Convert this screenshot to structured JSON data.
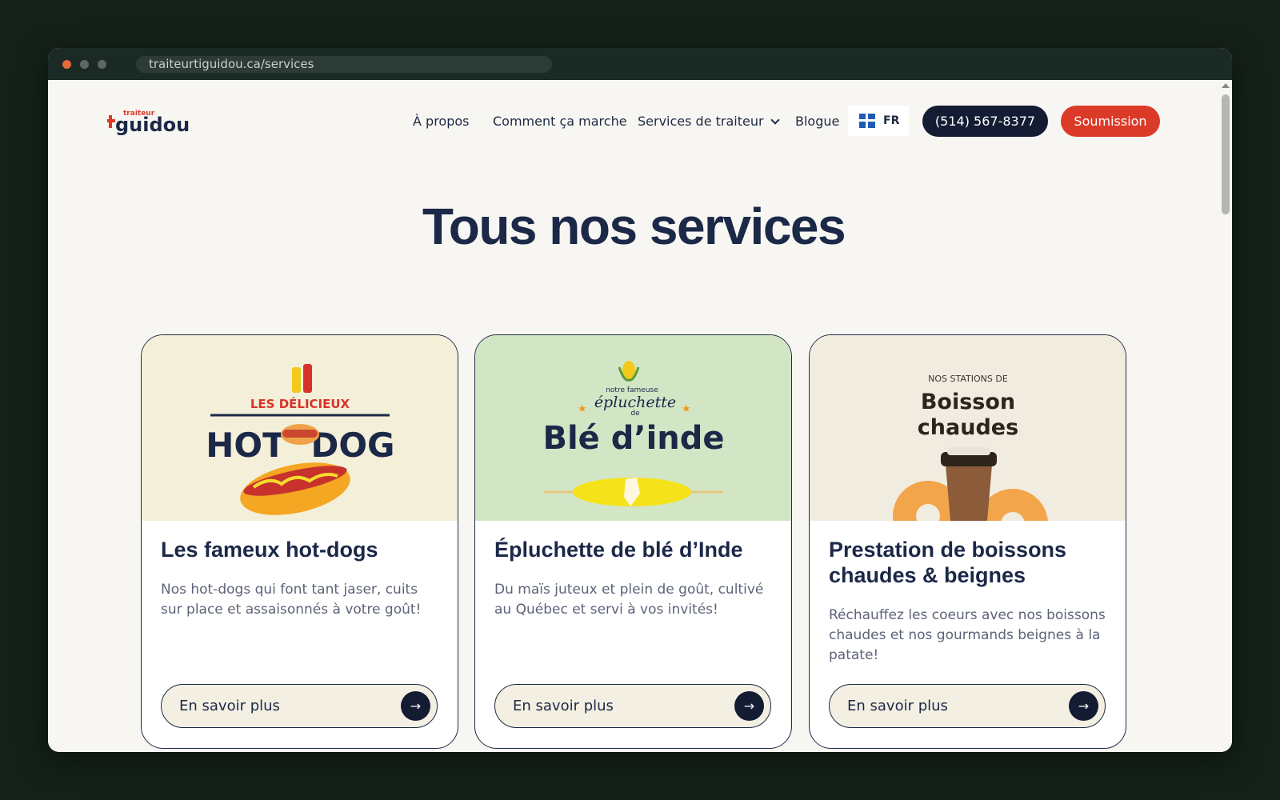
{
  "browser": {
    "url": "traiteurtiguidou.ca/services"
  },
  "nav": {
    "logo_small": "traiteur",
    "logo_big": "guidou",
    "links": [
      "À propos",
      "Comment ça marche",
      "Services de traiteur",
      "Blogue"
    ],
    "lang": "FR",
    "phone": "(514) 567-8377",
    "cta": "Soumission"
  },
  "hero": {
    "title": "Tous nos services"
  },
  "cards": [
    {
      "title": "Les fameux hot-dogs",
      "desc": "Nos hot-dogs qui font tant jaser, cuits sur place et assaisonnés à votre goût!",
      "button": "En savoir plus",
      "img_bg": "#f4efd8",
      "img_text": [
        "LES DÉLICIEUX",
        "HOT",
        "DOG"
      ]
    },
    {
      "title": "Épluchette de blé d’Inde",
      "desc": "Du maïs juteux et plein de goût, cultivé au Québec et servi à vos invités!",
      "button": "En savoir plus",
      "img_bg": "#d2e6c6",
      "img_text": [
        "notre fameuse",
        "épluchette",
        "de",
        "Blé d’inde"
      ]
    },
    {
      "title": "Prestation de boissons chaudes & beignes",
      "desc": "Réchauffez les coeurs avec nos boissons chaudes et nos gourmands beignes à la patate!",
      "button": "En savoir plus",
      "img_bg": "#f1ece0",
      "img_text": [
        "NOS STATIONS DE",
        "Boisson",
        "chaudes"
      ]
    }
  ],
  "colors": {
    "navy": "#131c33",
    "red": "#dc3a28",
    "page_bg": "#f8f6f2"
  }
}
